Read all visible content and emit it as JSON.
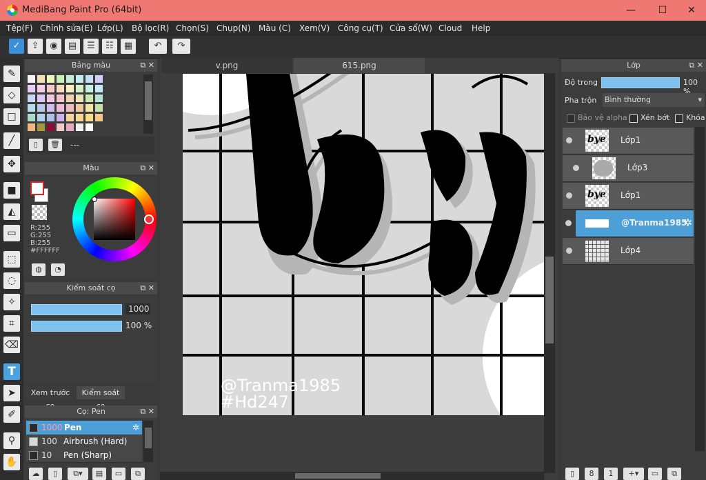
{
  "window": {
    "title": "MediBang Paint Pro (64bit)",
    "minimize": "—",
    "maximize": "☐",
    "close": "✕"
  },
  "menu": [
    "Tệp(F)",
    "Chỉnh sửa(E)",
    "Lớp(L)",
    "Bộ lọc(R)",
    "Chọn(S)",
    "Chụp(N)",
    "Màu (C)",
    "Xem(V)",
    "Công cụ(T)",
    "Cửa sổ(W)",
    "Cloud",
    "Help"
  ],
  "tabs": [
    {
      "label": "v.png"
    },
    {
      "label": "615.png"
    }
  ],
  "palette_panel": {
    "title": "Bảng màu",
    "palette_name": "---"
  },
  "color_panel": {
    "title": "Màu",
    "r": "R:255",
    "g": "G:255",
    "b": "B:255",
    "hex": "#FFFFFF",
    "primary_color": "#ffffff",
    "secondary_color": "#ffffff"
  },
  "brush_control": {
    "title": "Kiểm soát cọ",
    "size": "1000",
    "opacity": "100 %",
    "size_fraction": 1.0,
    "opacity_fraction": 1.0
  },
  "sub_tabs": [
    "Xem trước cọ",
    "Kiểm soát cọ"
  ],
  "brush_panel": {
    "title": "Cọ: Pen",
    "items": [
      {
        "size": "1000",
        "name": "Pen",
        "selected": true
      },
      {
        "size": "100",
        "name": "Airbrush (Hard)",
        "selected": false
      },
      {
        "size": "10",
        "name": "Pen (Sharp)",
        "selected": false
      }
    ]
  },
  "layer_panel": {
    "title": "Lớp",
    "opacity_label": "Độ trong",
    "opacity_value": "100 %",
    "opacity_fraction": 1.0,
    "blend_label": "Pha trộn",
    "blend_value": "Bình thường",
    "protect_alpha": "Bảo vệ alpha",
    "clipping": "Xén bớt",
    "lock": "Khóa",
    "layers": [
      {
        "name": "Lớp1",
        "selected": false,
        "clipped": false,
        "thumb": "bye"
      },
      {
        "name": "Lớp3",
        "selected": false,
        "clipped": true,
        "thumb": "gray"
      },
      {
        "name": "Lớp1",
        "selected": false,
        "clipped": false,
        "thumb": "bye"
      },
      {
        "name": "@Tranma1985",
        "selected": true,
        "clipped": false,
        "thumb": "text"
      },
      {
        "name": "Lớp4",
        "selected": false,
        "clipped": false,
        "thumb": "grid"
      }
    ]
  },
  "canvas": {
    "watermark_line1": "@Tranma1985",
    "watermark_line2": "#Hd247",
    "thumb_text": "bye"
  }
}
